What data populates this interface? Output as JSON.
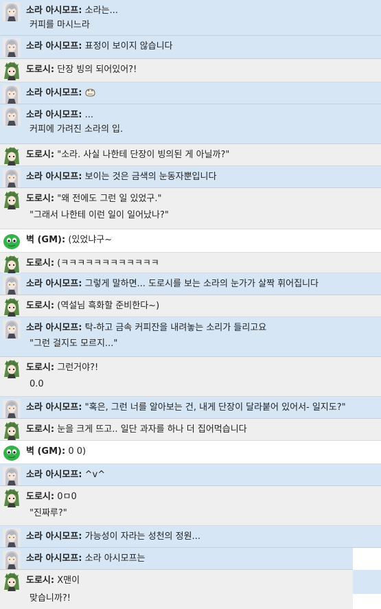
{
  "colors": {
    "sora_row": "#d6e6f5",
    "dorosi_row": "#efefef",
    "divider": "#b7d3ec"
  },
  "messages": [
    {
      "avatar": "sora-avatar-icon",
      "speaker": "소라 아시모프:",
      "text": "소라는...",
      "text2": "커피를 마시느라"
    },
    {
      "avatar": "sora-avatar-icon",
      "speaker": "소라 아시모프:",
      "text": "표정이 보이지 않습니다"
    },
    {
      "avatar": "dorosi-avatar-icon",
      "speaker": "도로시:",
      "text": "단장 빙의 되어있어?!"
    },
    {
      "avatar": "sora-avatar-icon",
      "speaker": "소라 아시모프:",
      "text": ""
    },
    {
      "avatar": "sora-avatar-icon",
      "speaker": "소라 아시모프:",
      "text": "...",
      "text2": "커피에 가려진 소라의 입."
    },
    {
      "avatar": "dorosi-avatar-icon",
      "speaker": "도로시:",
      "text": "\"소라. 사실 나한테 단장이 빙의된 게 아닐까?\""
    },
    {
      "avatar": "sora-avatar-icon",
      "speaker": "소라 아시모프:",
      "text": "보이는 것은 금색의 눈동자뿐입니다"
    },
    {
      "avatar": "dorosi-avatar-icon",
      "speaker": "도로시:",
      "text": "\"왜 전에도 그런 일 있었구.\"",
      "text2": "\"그래서 나한테 이런 일이 일어났나?\""
    },
    {
      "avatar": "gm-avatar-icon",
      "speaker": "벽 (GM):",
      "text": "(있었냐구~"
    },
    {
      "avatar": "dorosi-avatar-icon",
      "speaker": "도로시:",
      "text": "(ㅋㅋㅋㅋㅋㅋㅋㅋㅋㅋㅋㅋ"
    },
    {
      "avatar": "sora-avatar-icon",
      "speaker": "소라 아시모프:",
      "text": "그렇게 말하면... 도로시를 보는 소라의 눈가가 살짝 휘어집니다"
    },
    {
      "avatar": "dorosi-avatar-icon",
      "speaker": "도로시:",
      "text": "(역설님 흑화할 준비한다~)"
    },
    {
      "avatar": "sora-avatar-icon",
      "speaker": "소라 아시모프:",
      "text": "탁-하고 금속 커피잔을 내려놓는 소리가 들리고요",
      "text2": "\"그런 걸지도 모르지...\""
    },
    {
      "avatar": "dorosi-avatar-icon",
      "speaker": "도로시:",
      "text": "그런거야?!",
      "text2": "0.0"
    },
    {
      "avatar": "sora-avatar-icon",
      "speaker": "소라 아시모프:",
      "text": "\"혹은, 그런 너를 알아보는 건, 내게 단장이 달라붙어 있어서- 일지도?\""
    },
    {
      "avatar": "dorosi-avatar-icon",
      "speaker": "도로시:",
      "text": "눈을 크게 뜨고.. 일단 과자를 하나 더 집어먹습니다"
    },
    {
      "avatar": "gm-avatar-icon",
      "speaker": "벽 (GM):",
      "text": "0 0)"
    },
    {
      "avatar": "sora-avatar-icon",
      "speaker": "소라 아시모프:",
      "text": "^v^"
    },
    {
      "avatar": "dorosi-avatar-icon",
      "speaker": "도로시:",
      "text": "0ㅁ0",
      "text2": "\"진짜루?\""
    },
    {
      "avatar": "sora-avatar-icon",
      "speaker": "소라 아시모프:",
      "text": "가능성이 자라는 성천의 정원..."
    },
    {
      "avatar": "sora-avatar-icon",
      "speaker": "소라 아시모프:",
      "text": "소라 아시모프는"
    },
    {
      "avatar": "dorosi-avatar-icon",
      "speaker": "도로시:",
      "text": "X맨이",
      "text2": "맞습니까?!"
    }
  ]
}
